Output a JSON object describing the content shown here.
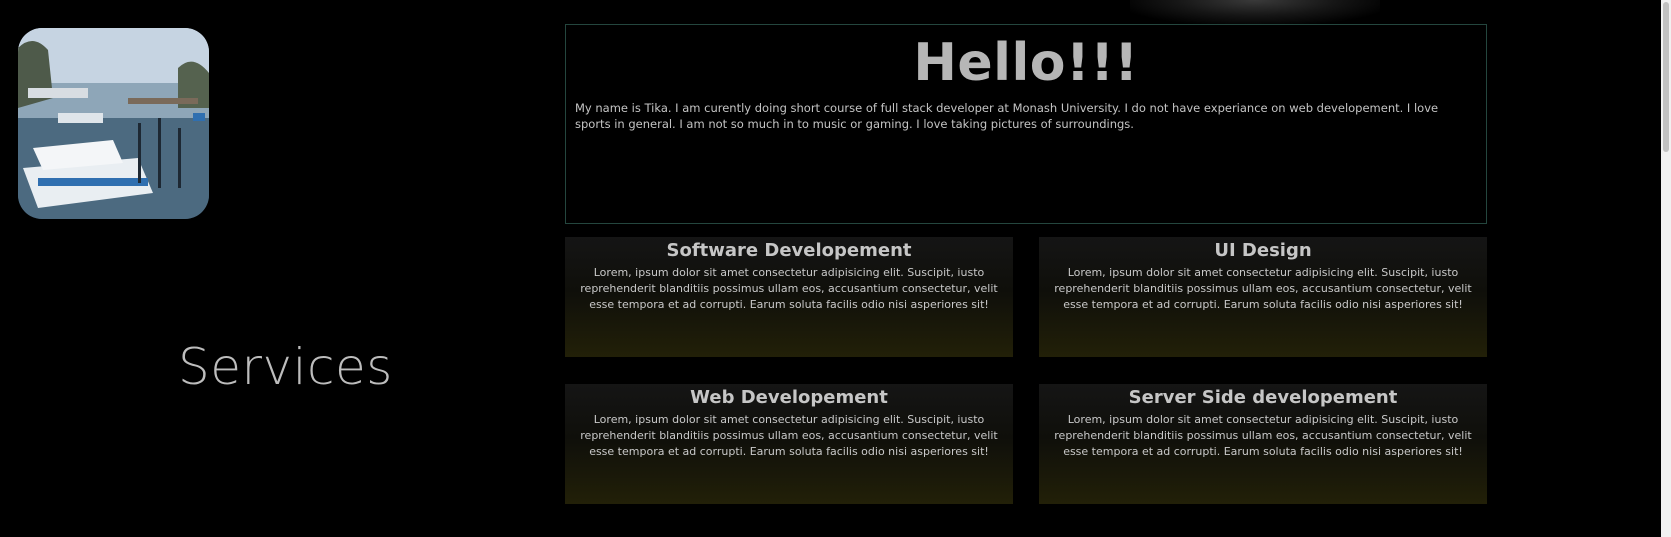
{
  "intro": {
    "title": "Hello!!!",
    "text": "My name is Tika. I am curently doing short course of full stack developer at Monash University. I do not have experiance on web developement. I love sports in general. I am not so much in to music or gaming. I love taking pictures of surroundings."
  },
  "services": {
    "heading": "Services",
    "cards": [
      {
        "title": "Software Developement",
        "text": "Lorem, ipsum dolor sit amet consectetur adipisicing elit. Suscipit, iusto reprehenderit blanditiis possimus ullam eos, accusantium consectetur, velit esse tempora et ad corrupti. Earum soluta facilis odio nisi asperiores sit!"
      },
      {
        "title": "UI Design",
        "text": "Lorem, ipsum dolor sit amet consectetur adipisicing elit. Suscipit, iusto reprehenderit blanditiis possimus ullam eos, accusantium consectetur, velit esse tempora et ad corrupti. Earum soluta facilis odio nisi asperiores sit!"
      },
      {
        "title": "Web Developement",
        "text": "Lorem, ipsum dolor sit amet consectetur adipisicing elit. Suscipit, iusto reprehenderit blanditiis possimus ullam eos, accusantium consectetur, velit esse tempora et ad corrupti. Earum soluta facilis odio nisi asperiores sit!"
      },
      {
        "title": "Server Side developement",
        "text": "Lorem, ipsum dolor sit amet consectetur adipisicing elit. Suscipit, iusto reprehenderit blanditiis possimus ullam eos, accusantium consectetur, velit esse tempora et ad corrupti. Earum soluta facilis odio nisi asperiores sit!"
      }
    ]
  },
  "colors": {
    "background": "#000000",
    "intro_border": "#24463e",
    "card_gradient_bottom": "#222008"
  },
  "icons": {
    "profile_photo": "marina-boats-photo"
  }
}
